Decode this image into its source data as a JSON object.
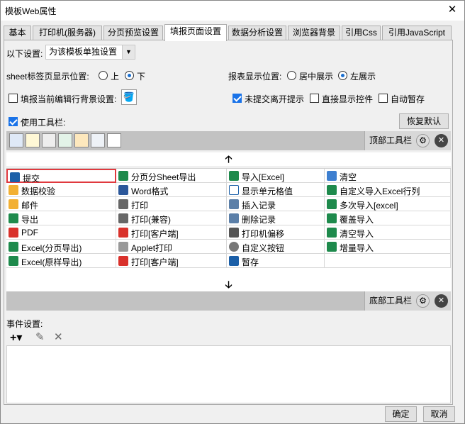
{
  "window": {
    "title": "模板Web属性",
    "close_glyph": "✕"
  },
  "tabs": [
    {
      "label": "基本"
    },
    {
      "label": "打印机(服务器)"
    },
    {
      "label": "分页预览设置"
    },
    {
      "label": "填报页面设置"
    },
    {
      "label": "数据分析设置"
    },
    {
      "label": "浏览器背景"
    },
    {
      "label": "引用Css"
    },
    {
      "label": "引用JavaScript"
    }
  ],
  "settings": {
    "scope_label": "以下设置:",
    "scope_value": "为该模板单独设置",
    "sheet_pos_label": "sheet标签页显示位置:",
    "sheet_top": "上",
    "sheet_bottom": "下",
    "report_pos_label": "报表显示位置:",
    "report_center": "居中展示",
    "report_left": "左展示",
    "fill_bg_label": "填报当前编辑行背景设置:",
    "unsubmit_label": "未提交离开提示",
    "direct_ctrl_label": "直接显示控件",
    "autosave_label": "自动暂存",
    "use_toolbar_label": "使用工具栏:",
    "restore_default": "恢复默认"
  },
  "top_toolbar": {
    "label": "顶部工具栏",
    "gear": "⚙",
    "x": "✕"
  },
  "bottom_toolbar": {
    "label": "底部工具栏",
    "gear": "⚙",
    "x": "✕"
  },
  "arrows": {
    "up": "🡡",
    "down": "🡣"
  },
  "buttons_grid": [
    [
      "提交",
      "分页分Sheet导出",
      "导入[Excel]",
      "清空"
    ],
    [
      "数据校验",
      "Word格式",
      "显示单元格值",
      "自定义导入Excel行列"
    ],
    [
      "邮件",
      "打印",
      "插入记录",
      "多次导入[excel]"
    ],
    [
      "导出",
      "打印(兼容)",
      "删除记录",
      "覆盖导入"
    ],
    [
      "PDF",
      "打印[客户端]",
      "打印机偏移",
      "清空导入"
    ],
    [
      "Excel(分页导出)",
      "Applet打印",
      "自定义按钮",
      "增量导入"
    ],
    [
      "Excel(原样导出)",
      "打印[客户端]",
      "暂存",
      ""
    ]
  ],
  "icon_colors": {
    "save": "#1b5fa8",
    "excel": "#1e8a4c",
    "pdf": "#d9312b",
    "mail": "#f2b033",
    "print": "#666666",
    "word": "#2b579a"
  },
  "events": {
    "label": "事件设置:",
    "add": "+▾",
    "edit": "✎",
    "delete": "✕"
  },
  "footer": {
    "ok": "确定",
    "cancel": "取消"
  }
}
